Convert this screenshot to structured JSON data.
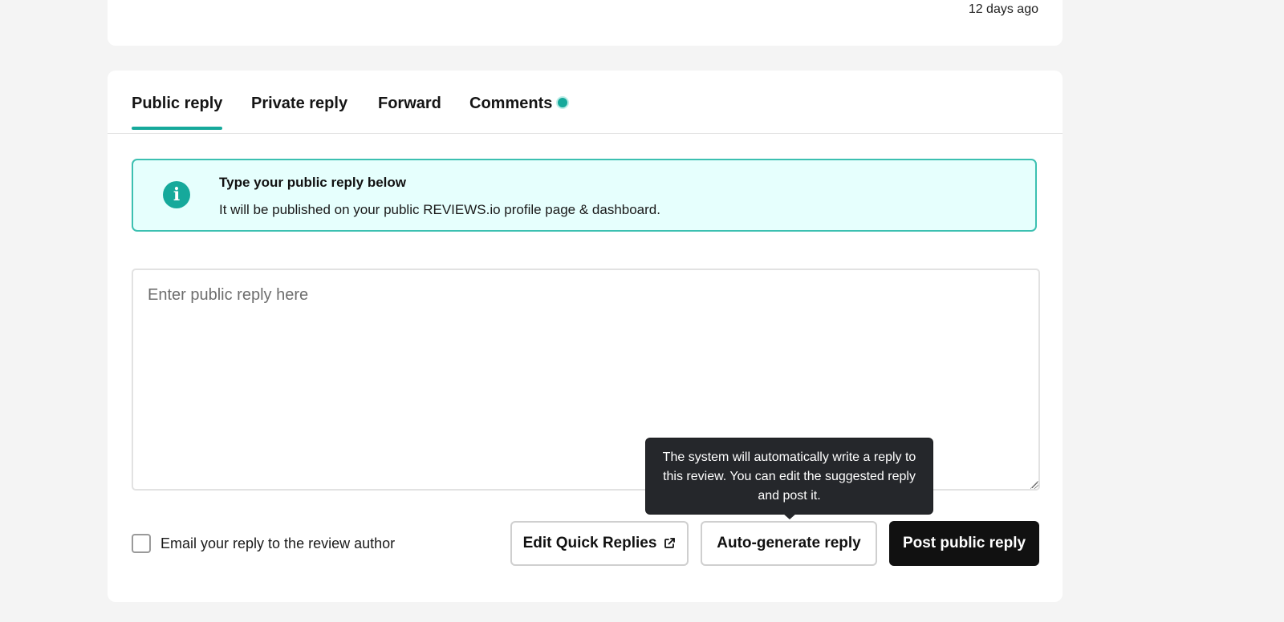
{
  "review": {
    "timestamp": "12 days ago"
  },
  "tabs": [
    {
      "label": "Public reply",
      "active": true
    },
    {
      "label": "Private reply",
      "active": false
    },
    {
      "label": "Forward",
      "active": false
    },
    {
      "label": "Comments",
      "active": false,
      "indicator": true
    }
  ],
  "info": {
    "icon": "info-icon",
    "title": "Type your public reply below",
    "text": "It will be published on your public REVIEWS.io profile page & dashboard."
  },
  "reply": {
    "placeholder": "Enter public reply here",
    "value": ""
  },
  "email_option": {
    "label": "Email your reply to the review author",
    "checked": false
  },
  "buttons": {
    "edit_quick_replies": "Edit Quick Replies",
    "auto_generate": "Auto-generate reply",
    "post_public": "Post public reply"
  },
  "tooltip": {
    "text": "The system will automatically write a reply to this review. You can edit the suggested reply and post it."
  },
  "colors": {
    "accent": "#16a99b",
    "info_bg": "#e6fffd",
    "dark_button": "#111111",
    "tooltip_bg": "#25272b"
  }
}
